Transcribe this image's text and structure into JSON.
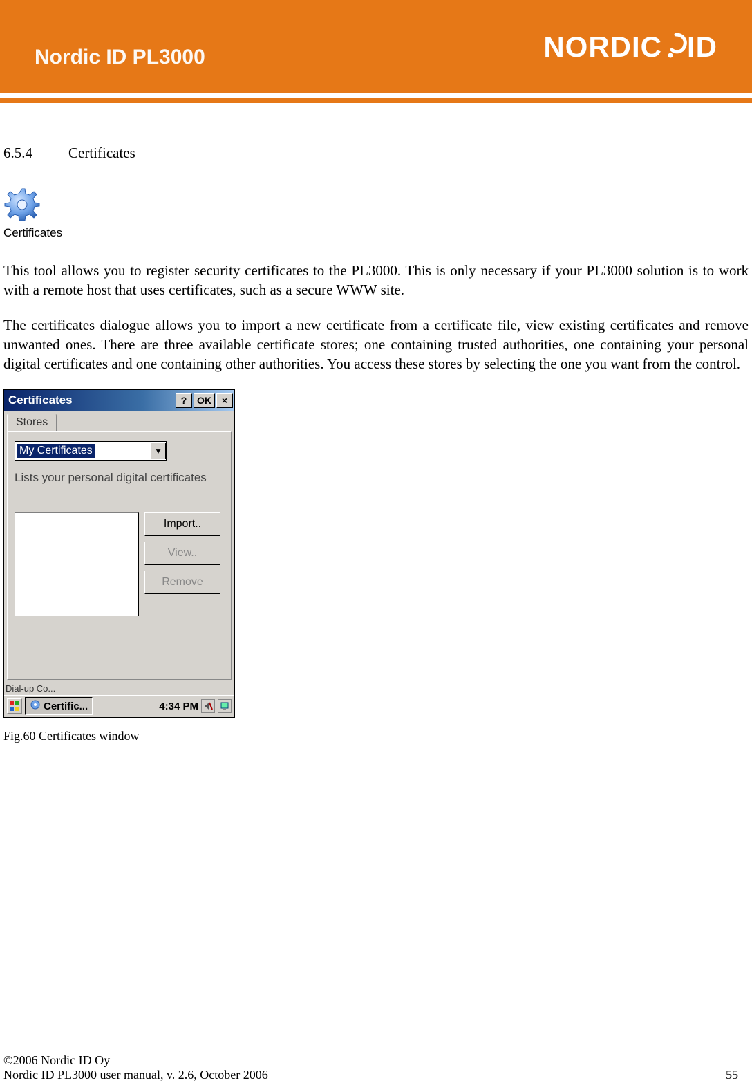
{
  "header": {
    "title": "Nordic ID PL3000",
    "logo_text_1": "NORDIC",
    "logo_text_2": "ID"
  },
  "section": {
    "number": "6.5.4",
    "title": "Certificates"
  },
  "cert_icon_label": "Certificates",
  "paragraphs": {
    "p1": "This tool allows you to register security certificates to the PL3000. This is only necessary if your PL3000 solution is to work with a remote host that uses certificates, such as a secure WWW site.",
    "p2": "The certificates dialogue allows you to import a new certificate from a certificate file, view existing certificates and remove unwanted ones. There are three available certificate stores; one containing trusted authorities, one containing your personal digital certificates and one containing other authorities. You access these stores by selecting the one you want from the control."
  },
  "dialog": {
    "title": "Certificates",
    "help_btn": "?",
    "ok_btn": "OK",
    "close_btn": "×",
    "tab": "Stores",
    "dropdown_value": "My Certificates",
    "description": "Lists your personal digital certificates",
    "buttons": {
      "import_label": "Import..",
      "view_label": "View..",
      "remove_label": "Remove"
    },
    "underbar": "Dial-up Co...",
    "taskbar": {
      "app_label": "Certific...",
      "clock": "4:34 PM"
    }
  },
  "figure_caption": "Fig.60 Certificates window",
  "footer": {
    "line1": "©2006 Nordic ID Oy",
    "line2": "Nordic ID PL3000 user manual, v. 2.6, October 2006",
    "page": "55"
  }
}
